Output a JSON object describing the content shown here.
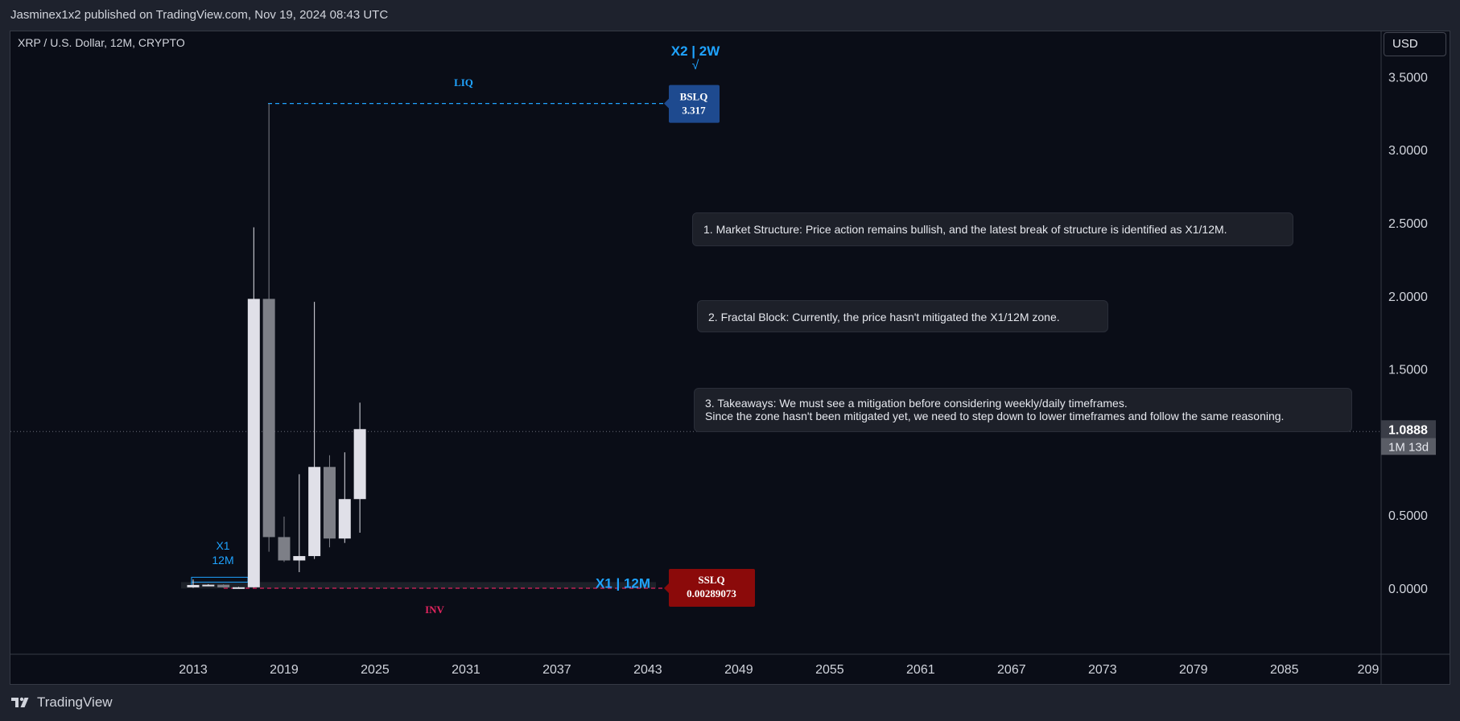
{
  "header": {
    "published_by": "Jasminex1x2 published on TradingView.com, Nov 19, 2024 08:43 UTC"
  },
  "symbol_title": "XRP / U.S. Dollar, 12M, CRYPTO",
  "currency_button": "USD",
  "footer": {
    "brand": "TradingView"
  },
  "colors": {
    "background": "#0a0d17",
    "bull_candle": "#e0e0e8",
    "bear_candle": "#7d7f87",
    "accent_blue": "#1fa3ff",
    "bslq_box": "#1e4a8f",
    "sslq_box": "#8b0a0a",
    "inv_red": "#e0245e"
  },
  "notes": [
    {
      "lines": [
        "1. Market Structure: Price action remains bullish, and the latest break of structure is identified as X1/12M."
      ]
    },
    {
      "lines": [
        "2. Fractal Block: Currently, the price hasn't mitigated the X1/12M zone."
      ]
    },
    {
      "lines": [
        "3. Takeaways: We must see a mitigation before considering weekly/daily timeframes.",
        "Since the zone hasn't been mitigated yet, we need to step down to lower timeframes and follow the same reasoning."
      ]
    }
  ],
  "chart_data": {
    "type": "candlestick",
    "title": "XRP / U.S. Dollar, 12M, CRYPTO",
    "xlabel": "",
    "ylabel": "",
    "x_ticks": [
      "2013",
      "2019",
      "2025",
      "2031",
      "2037",
      "2043",
      "2049",
      "2055",
      "2061",
      "2067",
      "2073",
      "2079",
      "2085",
      "209"
    ],
    "y_ticks": [
      "3.5000",
      "3.0000",
      "2.5000",
      "2.0000",
      "1.5000",
      "0.5000",
      "0.0000"
    ],
    "ylim": [
      -0.45,
      3.8
    ],
    "xlim": [
      2009.4,
      2096.6
    ],
    "grid": false,
    "candles": [
      {
        "year": 2013,
        "open": 0.006,
        "high": 0.06,
        "low": 0.003,
        "close": 0.022
      },
      {
        "year": 2014,
        "open": 0.022,
        "high": 0.028,
        "low": 0.015,
        "close": 0.024
      },
      {
        "year": 2015,
        "open": 0.024,
        "high": 0.027,
        "low": 0.004,
        "close": 0.006
      },
      {
        "year": 2016,
        "open": 0.006,
        "high": 0.009,
        "low": 0.005,
        "close": 0.0065
      },
      {
        "year": 2017,
        "open": 0.0065,
        "high": 2.47,
        "low": 0.005,
        "close": 1.98
      },
      {
        "year": 2018,
        "open": 1.98,
        "high": 3.317,
        "low": 0.25,
        "close": 0.35
      },
      {
        "year": 2019,
        "open": 0.35,
        "high": 0.49,
        "low": 0.18,
        "close": 0.19
      },
      {
        "year": 2020,
        "open": 0.19,
        "high": 0.78,
        "low": 0.11,
        "close": 0.22
      },
      {
        "year": 2021,
        "open": 0.22,
        "high": 1.96,
        "low": 0.2,
        "close": 0.83
      },
      {
        "year": 2022,
        "open": 0.83,
        "high": 0.91,
        "low": 0.28,
        "close": 0.34
      },
      {
        "year": 2023,
        "open": 0.34,
        "high": 0.93,
        "low": 0.31,
        "close": 0.61
      },
      {
        "year": 2024,
        "open": 0.61,
        "high": 1.27,
        "low": 0.38,
        "close": 1.0888
      }
    ],
    "levels": [
      {
        "label": "BSLQ",
        "value": 3.317,
        "display": "3.317",
        "tag": "LIQ",
        "color": "#1fa3ff"
      },
      {
        "label": "SSLQ",
        "value": 0.00289073,
        "display": "0.00289073",
        "tag": "INV",
        "color": "#e0245e"
      }
    ],
    "zone": {
      "label": "X1 | 12M",
      "marker_label": [
        "X1",
        "12M"
      ]
    },
    "top_annotation": {
      "label": "X2 | 2W",
      "check": "√"
    },
    "current_price": {
      "value": 1.0888,
      "display": "1.0888",
      "countdown": "1M 13d"
    }
  }
}
